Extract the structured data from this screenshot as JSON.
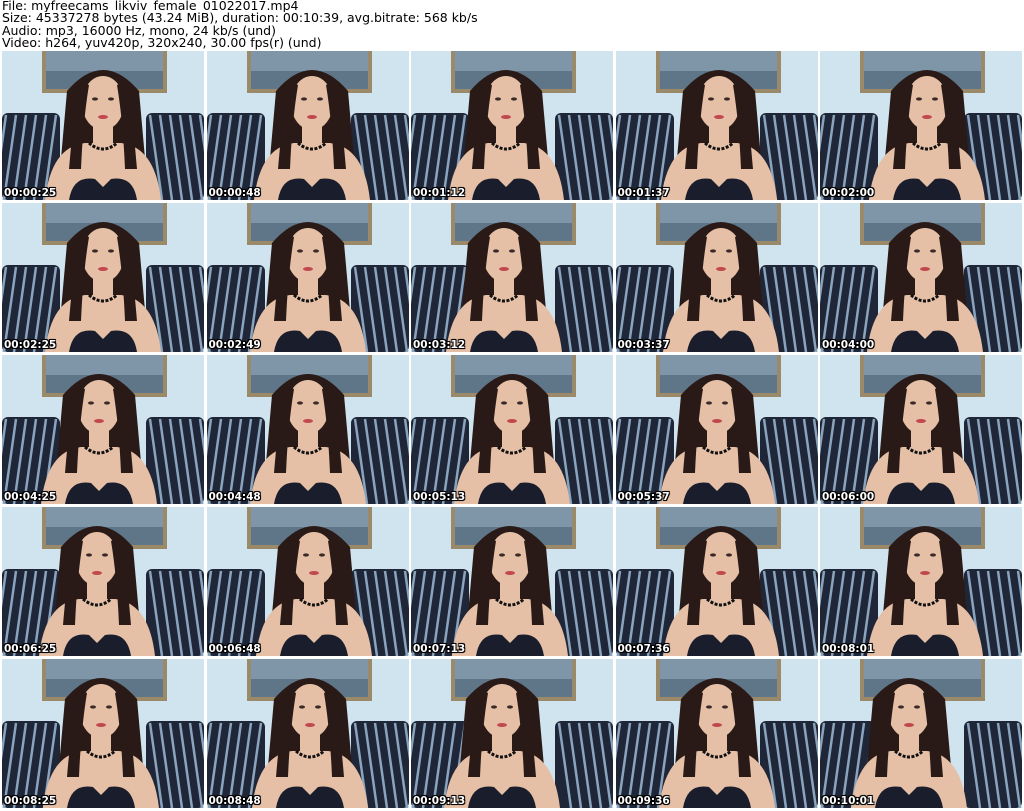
{
  "header": {
    "file_line": "File: myfreecams_likviv_female_01022017.mp4",
    "size_line": "Size: 45337278 bytes (43.24 MiB), duration: 00:10:39, avg.bitrate: 568 kb/s",
    "audio_line": "Audio: mp3, 16000 Hz, mono, 24 kb/s (und)",
    "video_line": "Video: h264, yuv420p, 320x240, 30.00 fps(r) (und)"
  },
  "colors": {
    "wall": "#cfe4ee",
    "cushion_dark": "#1f2638",
    "cushion_stripe": "#8aa4bd",
    "hair": "#2a1a17",
    "skin": "#e6c0a6",
    "garment": "#1a1d2c",
    "picture_frame": "#9a8a6a"
  },
  "thumbnails": [
    {
      "timestamp": "00:00:25"
    },
    {
      "timestamp": "00:00:48"
    },
    {
      "timestamp": "00:01:12"
    },
    {
      "timestamp": "00:01:37"
    },
    {
      "timestamp": "00:02:00"
    },
    {
      "timestamp": "00:02:25"
    },
    {
      "timestamp": "00:02:49"
    },
    {
      "timestamp": "00:03:12"
    },
    {
      "timestamp": "00:03:37"
    },
    {
      "timestamp": "00:04:00"
    },
    {
      "timestamp": "00:04:25"
    },
    {
      "timestamp": "00:04:48"
    },
    {
      "timestamp": "00:05:13"
    },
    {
      "timestamp": "00:05:37"
    },
    {
      "timestamp": "00:06:00"
    },
    {
      "timestamp": "00:06:25"
    },
    {
      "timestamp": "00:06:48"
    },
    {
      "timestamp": "00:07:13"
    },
    {
      "timestamp": "00:07:36"
    },
    {
      "timestamp": "00:08:01"
    },
    {
      "timestamp": "00:08:25"
    },
    {
      "timestamp": "00:08:48"
    },
    {
      "timestamp": "00:09:13"
    },
    {
      "timestamp": "00:09:36"
    },
    {
      "timestamp": "00:10:01"
    }
  ]
}
